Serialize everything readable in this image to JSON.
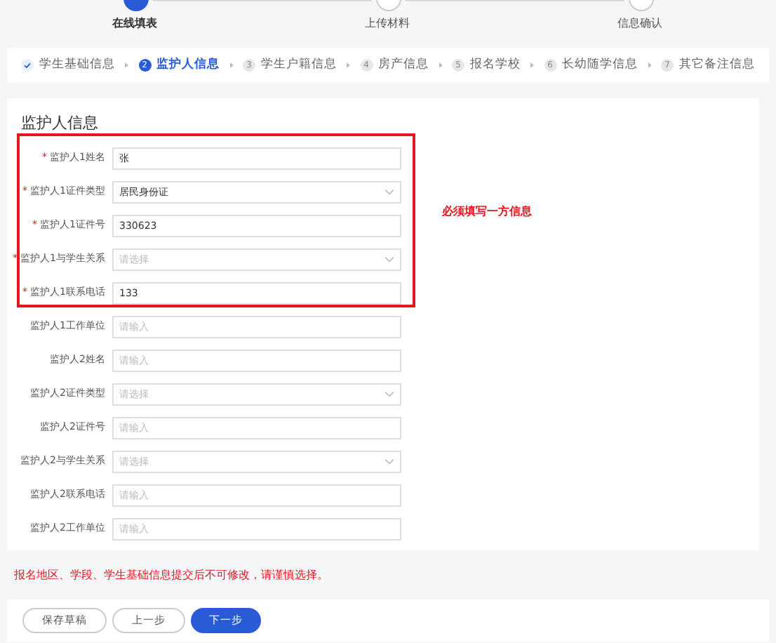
{
  "progress_steps": [
    {
      "label": "在线填表",
      "selected": true
    },
    {
      "label": "上传材料",
      "selected": false
    },
    {
      "label": "信息确认",
      "selected": false
    }
  ],
  "sub_steps": [
    {
      "done": true,
      "selected": false,
      "label": "学生基础信息"
    },
    {
      "done": false,
      "selected": true,
      "number": "2",
      "label": "监护人信息"
    },
    {
      "done": false,
      "selected": false,
      "number": "3",
      "label": "学生户籍信息"
    },
    {
      "done": false,
      "selected": false,
      "number": "4",
      "label": "房产信息"
    },
    {
      "done": false,
      "selected": false,
      "number": "5",
      "label": "报名学校"
    },
    {
      "done": false,
      "selected": false,
      "number": "6",
      "label": "长幼随学信息"
    },
    {
      "done": false,
      "selected": false,
      "number": "7",
      "label": "其它备注信息"
    }
  ],
  "section_title": "监护人信息",
  "required_group_note": "必须填写一方信息",
  "fields": [
    {
      "required_mark": "*",
      "label": "监护人1姓名",
      "kind": "input",
      "value": "张"
    },
    {
      "required_mark": "*",
      "label": "监护人1证件类型",
      "kind": "select",
      "value": "居民身份证"
    },
    {
      "required_mark": "*",
      "label": "监护人1证件号",
      "kind": "input",
      "value": "330623"
    },
    {
      "required_mark": "*",
      "label": "监护人1与学生关系",
      "kind": "select",
      "placeholder": "请选择"
    },
    {
      "required_mark": "*",
      "label": "监护人1联系电话",
      "kind": "input",
      "value": "133"
    },
    {
      "label": "监护人1工作单位",
      "kind": "input",
      "placeholder": "请输入"
    },
    {
      "label": "监护人2姓名",
      "kind": "input",
      "placeholder": "请输入"
    },
    {
      "label": "监护人2证件类型",
      "kind": "select",
      "placeholder": "请选择"
    },
    {
      "label": "监护人2证件号",
      "kind": "input",
      "placeholder": "请输入"
    },
    {
      "label": "监护人2与学生关系",
      "kind": "select",
      "placeholder": "请选择"
    },
    {
      "label": "监护人2联系电话",
      "kind": "input",
      "placeholder": "请输入"
    },
    {
      "label": "监护人2工作单位",
      "kind": "input",
      "placeholder": "请输入"
    }
  ],
  "warning": "报名地区、学段、学生基础信息提交后不可修改，请谨慎选择。",
  "buttons": [
    {
      "label": "保存草稿",
      "kind": "secondary"
    },
    {
      "label": "上一步",
      "kind": "secondary"
    },
    {
      "label": "下一步",
      "kind": "primary"
    }
  ]
}
